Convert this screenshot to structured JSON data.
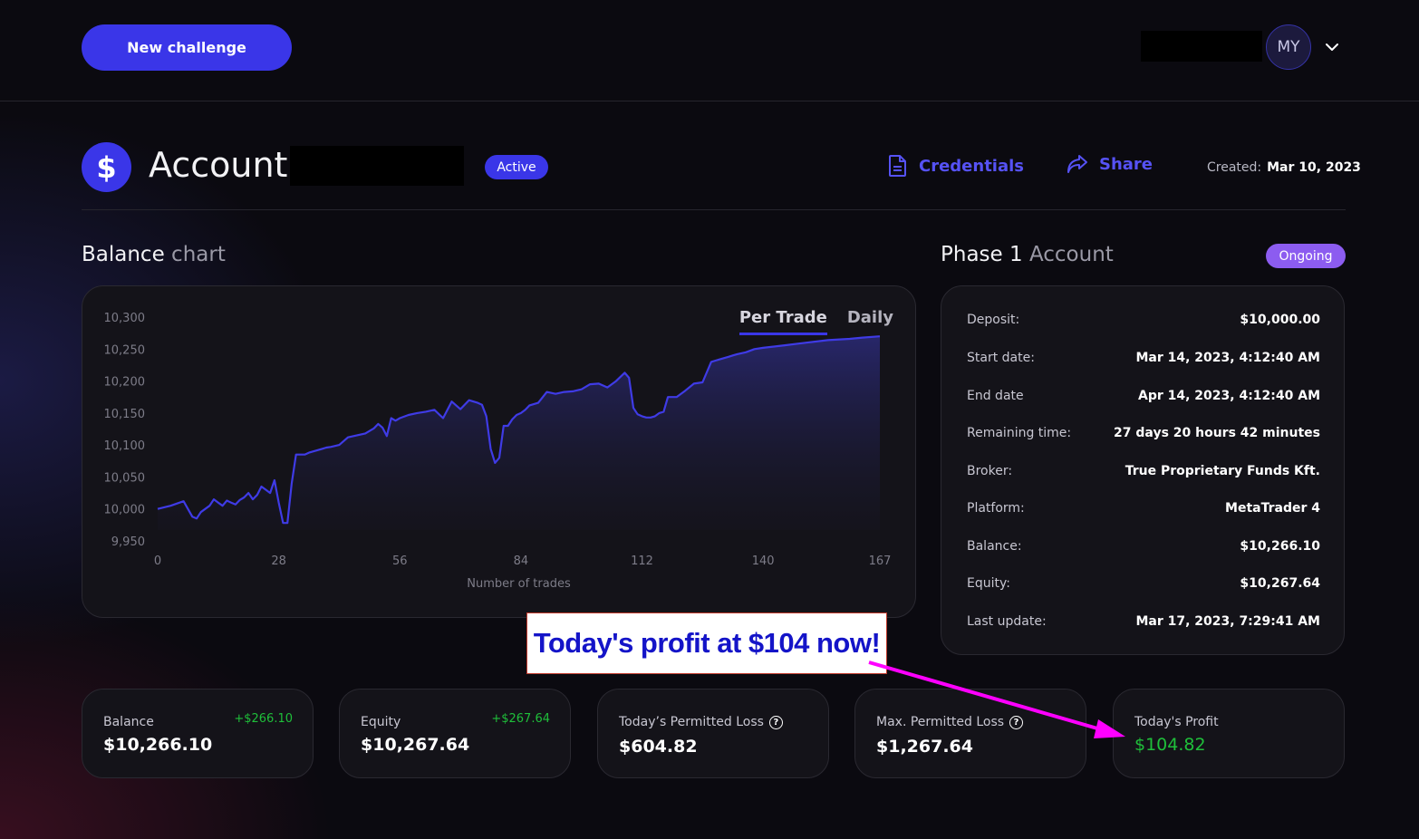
{
  "header": {
    "new_challenge_label": "New challenge",
    "avatar_initials": "MY"
  },
  "account": {
    "title": "Account",
    "status_badge": "Active",
    "credentials_label": "Credentials",
    "share_label": "Share",
    "created_label": "Created:",
    "created_value": "Mar 10, 2023"
  },
  "balance_section": {
    "title_bold": "Balance",
    "title_light": "chart",
    "tabs": [
      "Per Trade",
      "Daily"
    ],
    "active_tab": "Per Trade"
  },
  "phase_section": {
    "title_bold": "Phase 1",
    "title_light": "Account",
    "status_badge": "Ongoing",
    "rows": [
      {
        "label": "Deposit:",
        "value": "$10,000.00"
      },
      {
        "label": "Start date:",
        "value": "Mar 14, 2023, 4:12:40 AM"
      },
      {
        "label": "End date",
        "value": "Apr 14, 2023, 4:12:40 AM"
      },
      {
        "label": "Remaining time:",
        "value": "27 days 20 hours 42 minutes"
      },
      {
        "label": "Broker:",
        "value": "True Proprietary Funds Kft."
      },
      {
        "label": "Platform:",
        "value": "MetaTrader 4"
      },
      {
        "label": "Balance:",
        "value": "$10,266.10"
      },
      {
        "label": "Equity:",
        "value": "$10,267.64"
      },
      {
        "label": "Last update:",
        "value": "Mar 17, 2023, 7:29:41 AM"
      }
    ]
  },
  "stats": [
    {
      "label": "Balance",
      "value": "$10,266.10",
      "delta": "+$266.10"
    },
    {
      "label": "Equity",
      "value": "$10,267.64",
      "delta": "+$267.64"
    },
    {
      "label": "Today’s Permitted Loss",
      "value": "$604.82",
      "help": "?"
    },
    {
      "label": "Max. Permitted Loss",
      "value": "$1,267.64",
      "help": "?"
    },
    {
      "label": "Today's Profit",
      "value": "$104.82"
    }
  ],
  "annotation": {
    "callout_text": "Today's profit at $104 now!",
    "arrow_color": "#ff00ff"
  },
  "colors": {
    "accent": "#3a36e8",
    "ongoing": "#8c5cf0",
    "positive": "#1fbf3a",
    "line": "#3f3be6"
  },
  "chart_data": {
    "type": "area",
    "title": "",
    "xlabel": "Number of trades",
    "ylabel": "",
    "xlim": [
      0,
      167
    ],
    "ylim": [
      9950,
      10300
    ],
    "x_ticks": [
      0,
      28,
      56,
      84,
      112,
      140,
      167
    ],
    "y_ticks": [
      10300,
      10250,
      10200,
      10150,
      10100,
      10050,
      10000,
      9950
    ],
    "y_tick_labels": [
      "10,300",
      "10,250",
      "10,200",
      "10,150",
      "10,100",
      "10,050",
      "10,000",
      "9,950"
    ],
    "series": [
      {
        "x": [
          0,
          3,
          6,
          7,
          8,
          9,
          10,
          11,
          12,
          13,
          14,
          15,
          16,
          17,
          18,
          19,
          20,
          21,
          22,
          23,
          24,
          25,
          26,
          27,
          28,
          29,
          30,
          31,
          32,
          33,
          34,
          35,
          36,
          37,
          38,
          39,
          40,
          42,
          44,
          46,
          48,
          50,
          51,
          52,
          53,
          54,
          55,
          56,
          58,
          60,
          62,
          64,
          66,
          68,
          70,
          72,
          74,
          75,
          76,
          77,
          78,
          79,
          80,
          81,
          82,
          83,
          84,
          85,
          86,
          88,
          90,
          92,
          94,
          96,
          98,
          100,
          102,
          104,
          106,
          108,
          109,
          110,
          111,
          112,
          113,
          114,
          115,
          116,
          117,
          118,
          120,
          122,
          124,
          126,
          128,
          129,
          130,
          131,
          132,
          133,
          134,
          136,
          138,
          140,
          145,
          150,
          155,
          160,
          163,
          167
        ],
        "y": [
          10000,
          10005,
          10012,
          10000,
          9988,
          9985,
          9995,
          10000,
          10005,
          10015,
          10010,
          10005,
          10013,
          10010,
          10007,
          10014,
          10018,
          10025,
          10015,
          10022,
          10035,
          10030,
          10025,
          10045,
          10010,
          9978,
          9978,
          10040,
          10085,
          10085,
          10085,
          10088,
          10090,
          10092,
          10094,
          10096,
          10097,
          10100,
          10112,
          10115,
          10118,
          10126,
          10133,
          10127,
          10114,
          10142,
          10138,
          10142,
          10147,
          10150,
          10152,
          10155,
          10142,
          10168,
          10156,
          10170,
          10166,
          10163,
          10145,
          10094,
          10072,
          10080,
          10130,
          10130,
          10140,
          10147,
          10150,
          10155,
          10162,
          10166,
          10183,
          10180,
          10183,
          10184,
          10187,
          10195,
          10196,
          10190,
          10200,
          10213,
          10205,
          10158,
          10148,
          10145,
          10143,
          10143,
          10145,
          10150,
          10152,
          10175,
          10175,
          10185,
          10196,
          10198,
          10230,
          10232,
          10234,
          10236,
          10238,
          10240,
          10242,
          10245,
          10250,
          10252,
          10256,
          10260,
          10264,
          10266,
          10268,
          10270
        ]
      }
    ],
    "grid": false,
    "legend": "none"
  }
}
